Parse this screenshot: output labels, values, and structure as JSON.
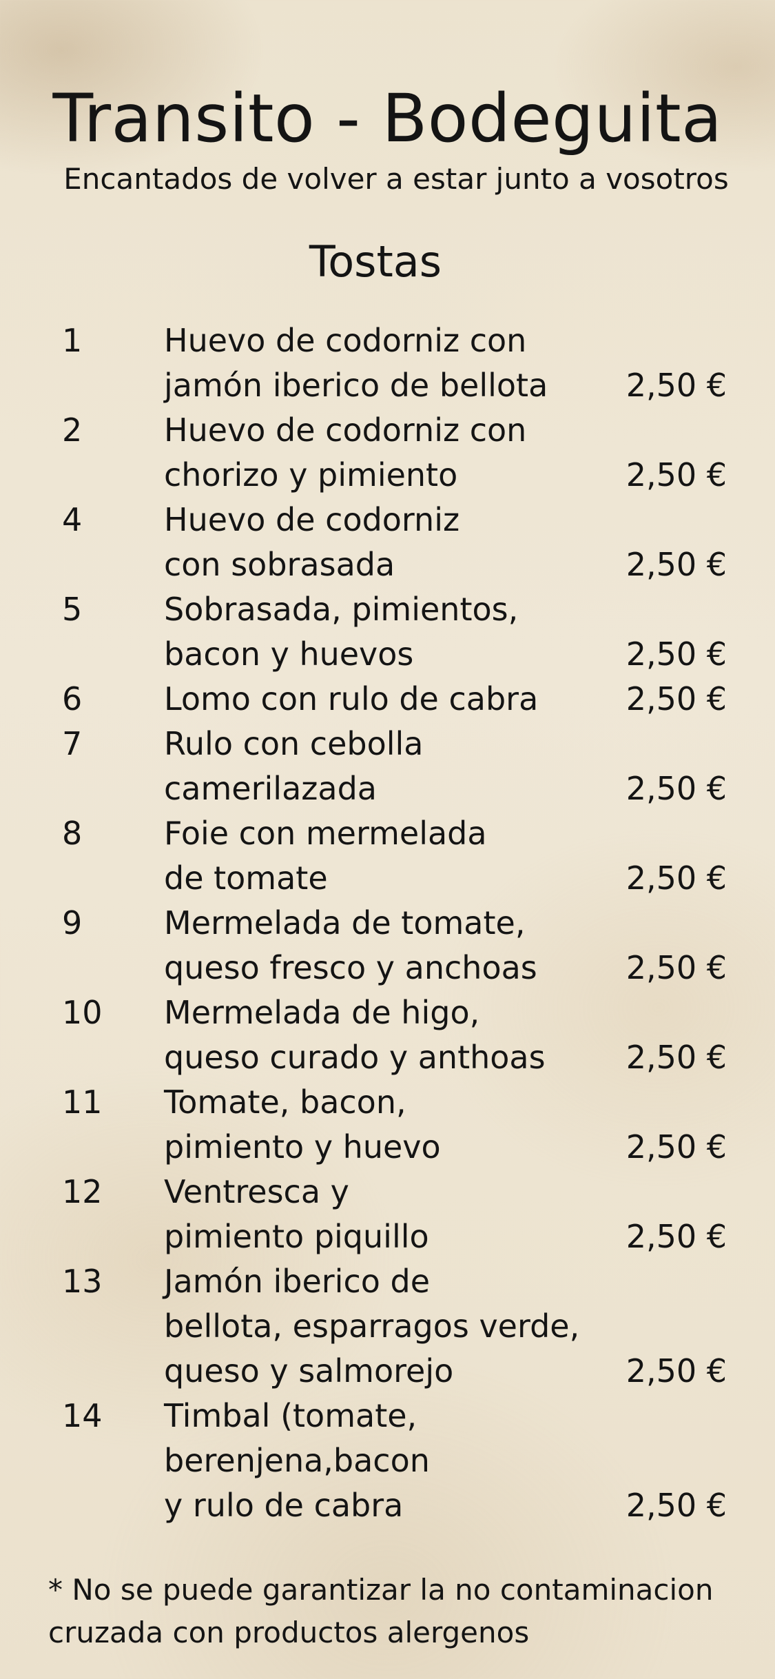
{
  "header": {
    "title": "Transito - Bodeguita",
    "subtitle": "Encantados de volver a estar junto a vosotros"
  },
  "section": {
    "title": "Tostas"
  },
  "items": [
    {
      "number": "1",
      "lines": [
        "Huevo de codorniz con",
        "jamón iberico de bellota"
      ],
      "price": "2,50 €"
    },
    {
      "number": "2",
      "lines": [
        "Huevo de codorniz con",
        "chorizo y pimiento"
      ],
      "price": "2,50 €"
    },
    {
      "number": "4",
      "lines": [
        "Huevo de codorniz",
        "con sobrasada"
      ],
      "price": "2,50 €"
    },
    {
      "number": "5",
      "lines": [
        "Sobrasada, pimientos,",
        "bacon y huevos"
      ],
      "price": "2,50 €"
    },
    {
      "number": "6",
      "lines": [
        "Lomo con rulo de cabra"
      ],
      "price": "2,50 €"
    },
    {
      "number": "7",
      "lines": [
        "Rulo con cebolla",
        "camerilazada"
      ],
      "price": "2,50 €"
    },
    {
      "number": "8",
      "lines": [
        "Foie con mermelada",
        "de tomate"
      ],
      "price": "2,50 €"
    },
    {
      "number": "9",
      "lines": [
        "Mermelada de tomate,",
        "queso fresco y anchoas"
      ],
      "price": "2,50 €"
    },
    {
      "number": "10",
      "lines": [
        "Mermelada de higo,",
        "queso curado y anthoas"
      ],
      "price": "2,50 €"
    },
    {
      "number": "11",
      "lines": [
        "Tomate, bacon,",
        "pimiento y huevo"
      ],
      "price": "2,50 €"
    },
    {
      "number": "12",
      "lines": [
        "Ventresca y",
        "pimiento piquillo"
      ],
      "price": "2,50 €"
    },
    {
      "number": "13",
      "lines": [
        "Jamón iberico de",
        "bellota, esparragos verde,",
        "queso y salmorejo"
      ],
      "price": "2,50 €"
    },
    {
      "number": "14",
      "lines": [
        "Timbal (tomate,",
        "berenjena,bacon",
        "y rulo de cabra"
      ],
      "price": "2,50 €"
    }
  ],
  "footnote": {
    "lines": [
      "* No se puede garantizar la no contaminacion",
      "cruzada con productos alergenos"
    ]
  }
}
